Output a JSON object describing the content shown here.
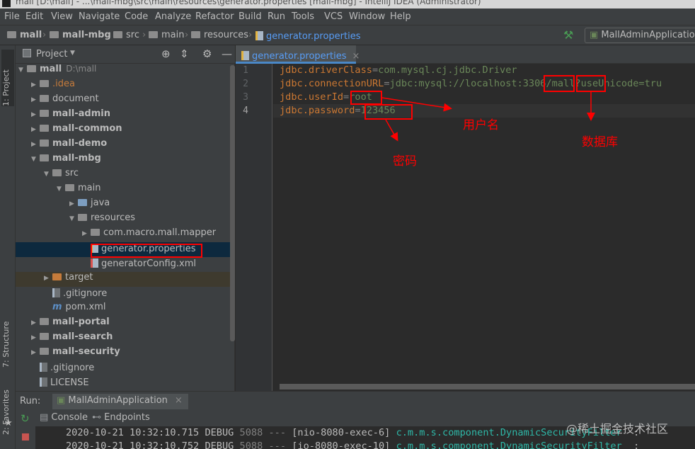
{
  "window": {
    "title": "mall [D:\\mall] - ...\\mall-mbg\\src\\main\\resources\\generator.properties [mall-mbg] - IntelliJ IDEA (Administrator)"
  },
  "menu": [
    "File",
    "Edit",
    "View",
    "Navigate",
    "Code",
    "Analyze",
    "Refactor",
    "Build",
    "Run",
    "Tools",
    "VCS",
    "Window",
    "Help"
  ],
  "breadcrumb": [
    "mall",
    "mall-mbg",
    "src",
    "main",
    "resources",
    "generator.properties"
  ],
  "run_config": "MallAdminApplication",
  "side_tabs": {
    "project": "1: Project",
    "structure": "7: Structure",
    "favorites": "2: Favorites"
  },
  "project_panel": {
    "title": "Project"
  },
  "tree": [
    {
      "label": "mall",
      "path": "D:\\mall",
      "indent": 0,
      "arrow": "down",
      "icon": "folder",
      "bold": true
    },
    {
      "label": ".idea",
      "indent": 1,
      "arrow": "right",
      "icon": "folder",
      "color": "#c57b3b"
    },
    {
      "label": "document",
      "indent": 1,
      "arrow": "right",
      "icon": "folder"
    },
    {
      "label": "mall-admin",
      "indent": 1,
      "arrow": "right",
      "icon": "folder",
      "bold": true
    },
    {
      "label": "mall-common",
      "indent": 1,
      "arrow": "right",
      "icon": "folder",
      "bold": true
    },
    {
      "label": "mall-demo",
      "indent": 1,
      "arrow": "right",
      "icon": "folder",
      "bold": true
    },
    {
      "label": "mall-mbg",
      "indent": 1,
      "arrow": "down",
      "icon": "folder",
      "bold": true
    },
    {
      "label": "src",
      "indent": 2,
      "arrow": "down",
      "icon": "folder"
    },
    {
      "label": "main",
      "indent": 3,
      "arrow": "down",
      "icon": "folder"
    },
    {
      "label": "java",
      "indent": 4,
      "arrow": "right",
      "icon": "folder-blue"
    },
    {
      "label": "resources",
      "indent": 4,
      "arrow": "down",
      "icon": "folder"
    },
    {
      "label": "com.macro.mall.mapper",
      "indent": 5,
      "arrow": "right",
      "icon": "folder"
    },
    {
      "label": "generator.properties",
      "indent": 5,
      "arrow": "",
      "icon": "prop",
      "selected": true
    },
    {
      "label": "generatorConfig.xml",
      "indent": 5,
      "arrow": "",
      "icon": "xml"
    },
    {
      "label": "target",
      "indent": 2,
      "arrow": "right",
      "icon": "folder-orange"
    },
    {
      "label": ".gitignore",
      "indent": 2,
      "arrow": "",
      "icon": "file"
    },
    {
      "label": "pom.xml",
      "indent": 2,
      "arrow": "",
      "icon": "maven"
    },
    {
      "label": "mall-portal",
      "indent": 1,
      "arrow": "right",
      "icon": "folder",
      "bold": true
    },
    {
      "label": "mall-search",
      "indent": 1,
      "arrow": "right",
      "icon": "folder",
      "bold": true
    },
    {
      "label": "mall-security",
      "indent": 1,
      "arrow": "right",
      "icon": "folder",
      "bold": true
    },
    {
      "label": ".gitignore",
      "indent": 1,
      "arrow": "",
      "icon": "file"
    },
    {
      "label": "LICENSE",
      "indent": 1,
      "arrow": "",
      "icon": "file"
    }
  ],
  "editor": {
    "tab": "generator.properties",
    "line_numbers": [
      "1",
      "2",
      "3",
      "4"
    ],
    "lines": [
      {
        "key": "jdbc.driverClass",
        "eq": "=",
        "value": "com.mysql.cj.jdbc.Driver"
      },
      {
        "key": "jdbc.connectionURL",
        "eq": "=",
        "value": "jdbc:mysql://localhost:3306/mall?useUnicode=tru"
      },
      {
        "key": "jdbc.userId",
        "eq": "=",
        "value": "root"
      },
      {
        "key": "jdbc.password",
        "eq": "=",
        "value": "123456"
      }
    ]
  },
  "annotations": {
    "username": "用户名",
    "database": "数据库",
    "password": "密码"
  },
  "run_panel": {
    "label": "Run:",
    "config": "MallAdminApplication",
    "tabs": [
      "Console",
      "Endpoints"
    ],
    "logs": [
      {
        "time": "2020-10-21 10:32:10.715",
        "level": "DEBUG",
        "pid": "5088",
        "sep": "---",
        "thread": "[nio-8080-exec-6]",
        "logger": "c.m.m.s.component.DynamicSecurityFilter",
        "colon": ":"
      },
      {
        "time": "2020-10-21 10:32:10.752",
        "level": "DEBUG",
        "pid": "5088",
        "sep": "---",
        "thread": "[io-8080-exec-10]",
        "logger": "c.m.m.s.component.DynamicSecurityFilter",
        "colon": ":"
      }
    ]
  },
  "watermark": "@稀土掘金技术社区"
}
